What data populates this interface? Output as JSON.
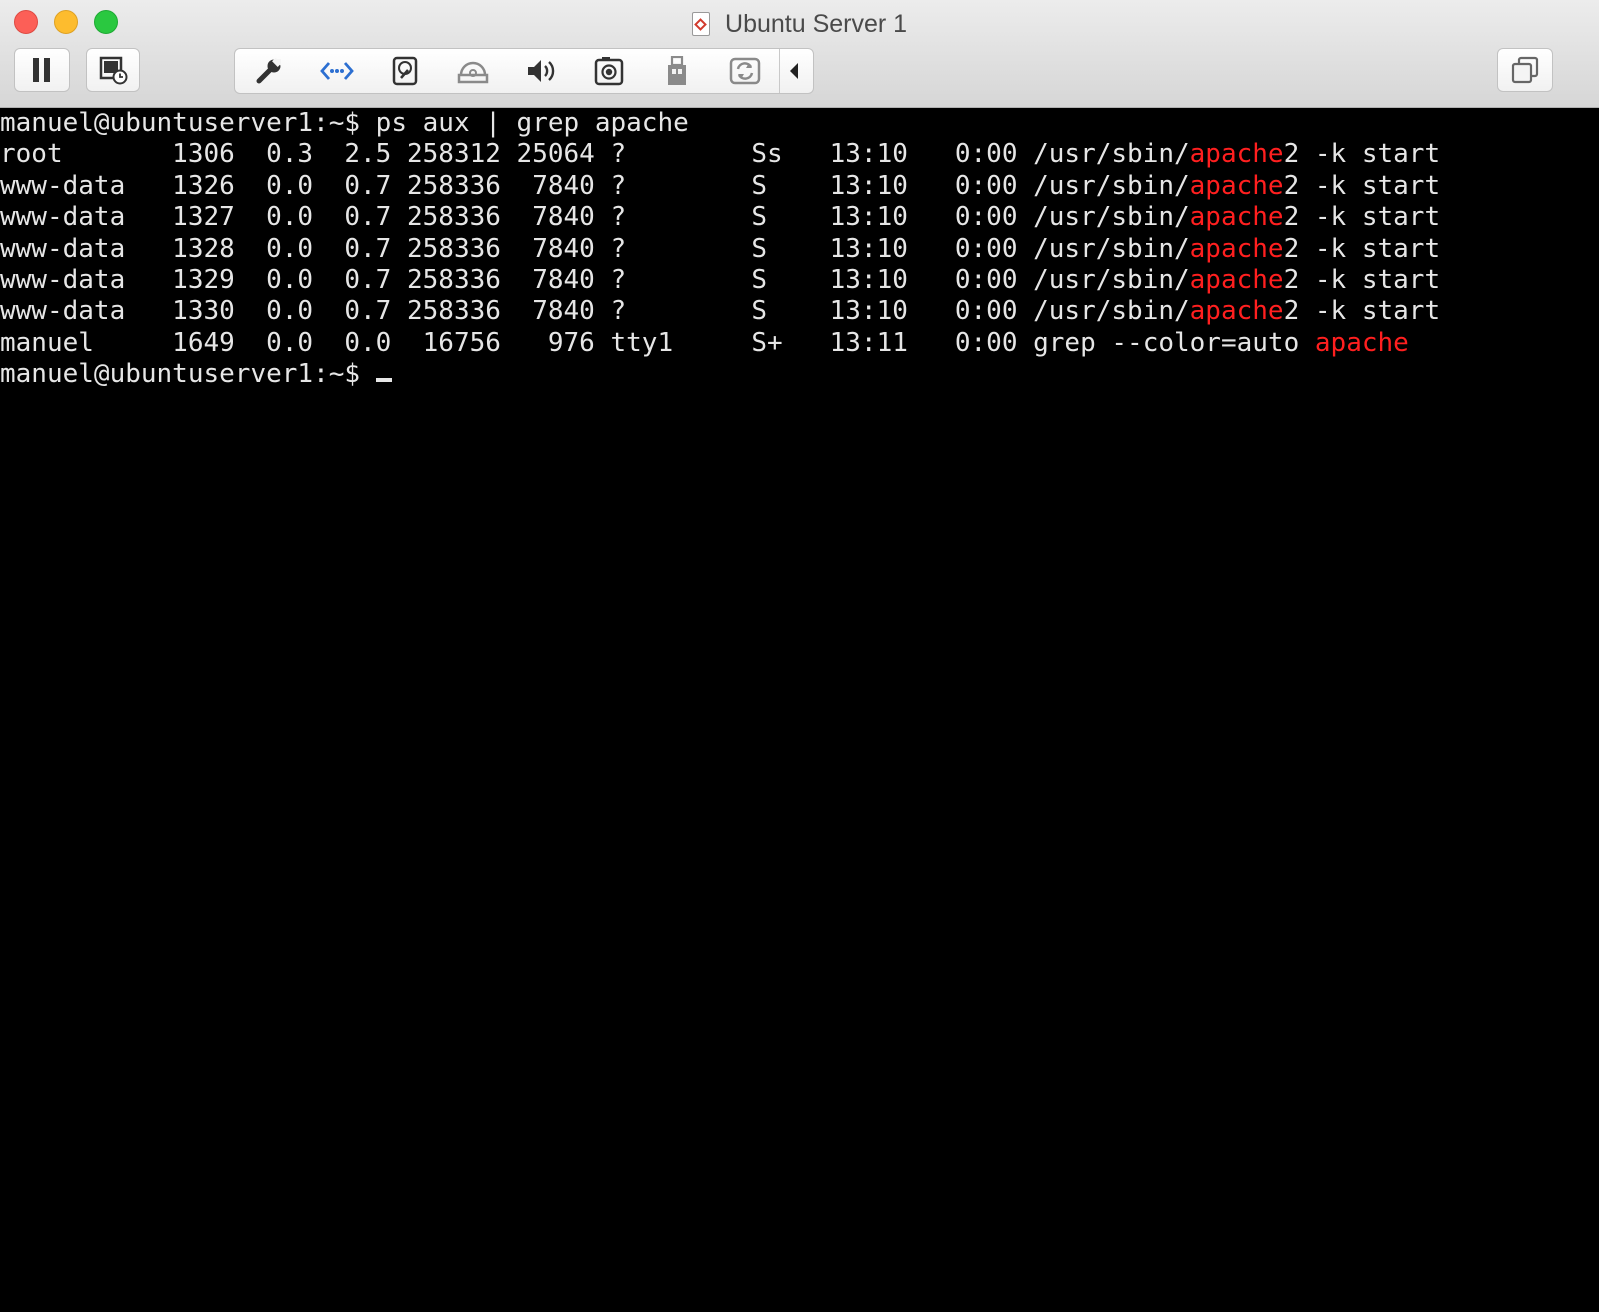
{
  "window": {
    "title": "Ubuntu Server 1"
  },
  "toolbar": {
    "pause_icon": "pause-icon",
    "snapshot_icon": "snapshot-icon",
    "items": [
      {
        "name": "settings",
        "icon": "wrench-icon"
      },
      {
        "name": "network",
        "icon": "network-icon"
      },
      {
        "name": "hard-disk",
        "icon": "hard-disk-icon"
      },
      {
        "name": "cd-dvd",
        "icon": "cd-dvd-icon"
      },
      {
        "name": "sound",
        "icon": "speaker-icon"
      },
      {
        "name": "camera",
        "icon": "camera-icon"
      },
      {
        "name": "usb",
        "icon": "usb-icon"
      },
      {
        "name": "sharing",
        "icon": "sharing-icon"
      }
    ],
    "collapse_icon": "chevron-left-icon",
    "restore_icon": "restore-windows-icon"
  },
  "terminal": {
    "lines": [
      {
        "segments": [
          {
            "text": "manuel@ubuntuserver1:~$ ps aux | grep apache",
            "hl": false
          }
        ]
      },
      {
        "segments": [
          {
            "text": "root       1306  0.3  2.5 258312 25064 ?        Ss   13:10   0:00 /usr/sbin/",
            "hl": false
          },
          {
            "text": "apache",
            "hl": true
          },
          {
            "text": "2 -k start",
            "hl": false
          }
        ]
      },
      {
        "segments": [
          {
            "text": "www-data   1326  0.0  0.7 258336  7840 ?        S    13:10   0:00 /usr/sbin/",
            "hl": false
          },
          {
            "text": "apache",
            "hl": true
          },
          {
            "text": "2 -k start",
            "hl": false
          }
        ]
      },
      {
        "segments": [
          {
            "text": "www-data   1327  0.0  0.7 258336  7840 ?        S    13:10   0:00 /usr/sbin/",
            "hl": false
          },
          {
            "text": "apache",
            "hl": true
          },
          {
            "text": "2 -k start",
            "hl": false
          }
        ]
      },
      {
        "segments": [
          {
            "text": "www-data   1328  0.0  0.7 258336  7840 ?        S    13:10   0:00 /usr/sbin/",
            "hl": false
          },
          {
            "text": "apache",
            "hl": true
          },
          {
            "text": "2 -k start",
            "hl": false
          }
        ]
      },
      {
        "segments": [
          {
            "text": "www-data   1329  0.0  0.7 258336  7840 ?        S    13:10   0:00 /usr/sbin/",
            "hl": false
          },
          {
            "text": "apache",
            "hl": true
          },
          {
            "text": "2 -k start",
            "hl": false
          }
        ]
      },
      {
        "segments": [
          {
            "text": "www-data   1330  0.0  0.7 258336  7840 ?        S    13:10   0:00 /usr/sbin/",
            "hl": false
          },
          {
            "text": "apache",
            "hl": true
          },
          {
            "text": "2 -k start",
            "hl": false
          }
        ]
      },
      {
        "segments": [
          {
            "text": "manuel     1649  0.0  0.0  16756   976 tty1     S+   13:11   0:00 grep --color=auto ",
            "hl": false
          },
          {
            "text": "apache",
            "hl": true
          }
        ]
      },
      {
        "segments": [
          {
            "text": "manuel@ubuntuserver1:~$ ",
            "hl": false
          }
        ],
        "cursor": true
      }
    ]
  }
}
